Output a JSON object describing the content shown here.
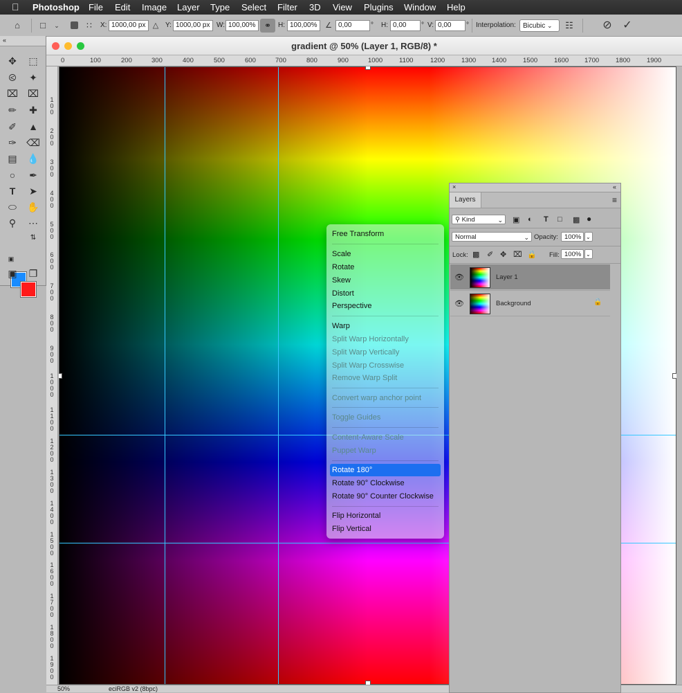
{
  "menubar": {
    "app_name": "Photoshop",
    "items": [
      "File",
      "Edit",
      "Image",
      "Layer",
      "Type",
      "Select",
      "Filter",
      "3D",
      "View",
      "Plugins",
      "Window",
      "Help"
    ]
  },
  "options_bar": {
    "x_label": "X:",
    "x_value": "1000,00 px",
    "y_label": "Y:",
    "y_value": "1000,00 px",
    "w_label": "W:",
    "w_value": "100,00%",
    "h_label": "H:",
    "h_value": "100,00%",
    "angle_value": "0,00",
    "angle_unit": "°",
    "hskew_label": "H:",
    "hskew_value": "0,00",
    "hskew_unit": "°",
    "vskew_label": "V:",
    "vskew_value": "0,00",
    "vskew_unit": "°",
    "interpolation_label": "Interpolation:",
    "interpolation_value": "Bicubic",
    "cancel_icon": "cancel-icon",
    "commit_icon": "checkmark-icon"
  },
  "document": {
    "title": "gradient @ 50% (Layer 1, RGB/8) *",
    "ruler_top": [
      "0",
      "100",
      "200",
      "300",
      "400",
      "500",
      "600",
      "700",
      "800",
      "900",
      "1000",
      "1100",
      "1200",
      "1300",
      "1400",
      "1500",
      "1600",
      "1700",
      "1800",
      "1900"
    ],
    "ruler_left": [
      "1 0 0",
      "2 0 0",
      "3 0 0",
      "4 0 0",
      "5 0 0",
      "6 0 0",
      "7 0 0",
      "8 0 0",
      "9 0 0",
      "1 0 0 0",
      "1 1 0 0",
      "1 2 0 0",
      "1 3 0 0",
      "1 4 0 0",
      "1 5 0 0",
      "1 6 0 0",
      "1 7 0 0",
      "1 8 0 0",
      "1 9 0 0"
    ],
    "zoom": "50%",
    "color_profile": "eciRGB v2 (8bpc)"
  },
  "context_menu": {
    "items": [
      {
        "label": "Free Transform",
        "enabled": true
      },
      {
        "label": "Scale",
        "enabled": true
      },
      {
        "label": "Rotate",
        "enabled": true
      },
      {
        "label": "Skew",
        "enabled": true
      },
      {
        "label": "Distort",
        "enabled": true
      },
      {
        "label": "Perspective",
        "enabled": true
      },
      {
        "label": "Warp",
        "enabled": true
      },
      {
        "label": "Split Warp Horizontally",
        "enabled": false
      },
      {
        "label": "Split Warp Vertically",
        "enabled": false
      },
      {
        "label": "Split Warp Crosswise",
        "enabled": false
      },
      {
        "label": "Remove Warp Split",
        "enabled": false
      },
      {
        "label": "Convert warp anchor point",
        "enabled": false
      },
      {
        "label": "Toggle Guides",
        "enabled": false
      },
      {
        "label": "Content-Aware Scale",
        "enabled": false
      },
      {
        "label": "Puppet Warp",
        "enabled": false
      },
      {
        "label": "Rotate 180°",
        "enabled": true,
        "highlighted": true
      },
      {
        "label": "Rotate 90° Clockwise",
        "enabled": true
      },
      {
        "label": "Rotate 90° Counter Clockwise",
        "enabled": true
      },
      {
        "label": "Flip Horizontal",
        "enabled": true
      },
      {
        "label": "Flip Vertical",
        "enabled": true
      }
    ]
  },
  "layers_panel": {
    "tab": "Layers",
    "filter_kind": "Kind",
    "blend_mode": "Normal",
    "opacity_label": "Opacity:",
    "opacity_value": "100%",
    "lock_label": "Lock:",
    "fill_label": "Fill:",
    "fill_value": "100%",
    "layers": [
      {
        "name": "Layer 1",
        "selected": true,
        "locked": false
      },
      {
        "name": "Background",
        "selected": false,
        "locked": true
      }
    ]
  },
  "colors": {
    "foreground": "#1a8cff",
    "background": "#ff1a1a",
    "guide": "#36c8ff",
    "menu_highlight": "#1c6ff0"
  }
}
